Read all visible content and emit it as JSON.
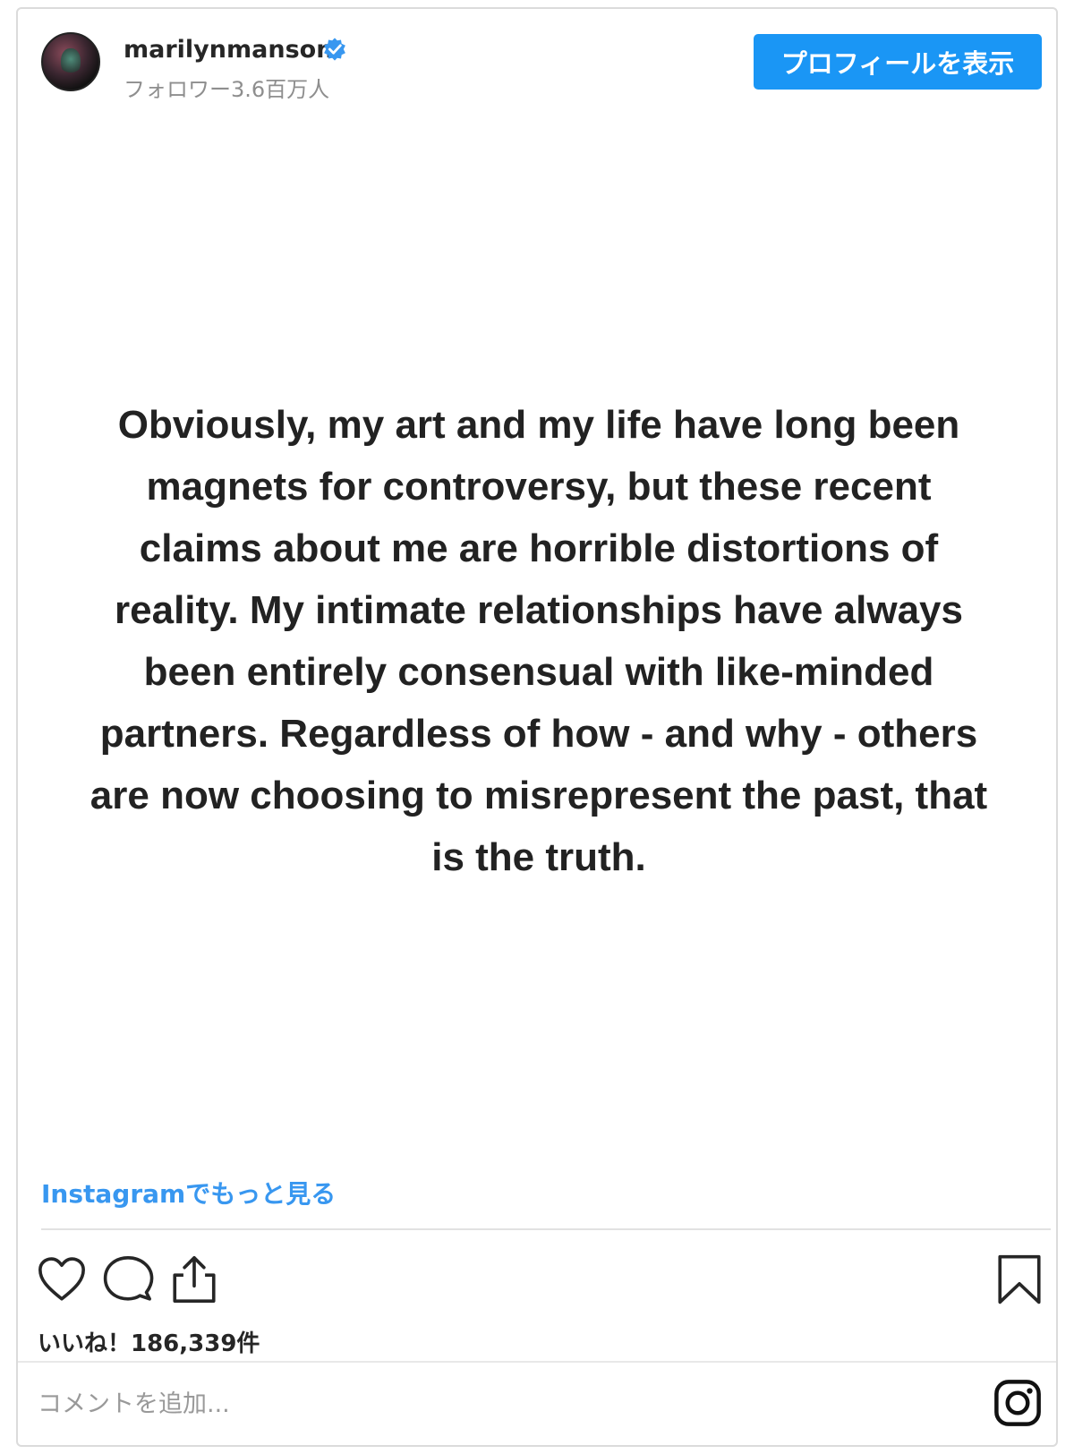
{
  "header": {
    "username": "marilynmanson",
    "followers": "フォロワー3.6百万人",
    "profile_button": "プロフィールを表示"
  },
  "post": {
    "text_lines": [
      "Obviously, my art and my life have long been",
      "magnets for controversy, but these recent",
      "claims about me are horrible distortions of",
      "reality. My intimate relationships have always",
      "been entirely consensual with like-minded",
      "partners. Regardless of how - and why - others",
      "are now choosing to misrepresent the past, that",
      "is the truth."
    ]
  },
  "more_link": "Instagramでもっと見る",
  "likes": "いいね！186,339件",
  "comment": {
    "placeholder": "コメントを追加..."
  },
  "icons": [
    "verified-icon",
    "heart-icon",
    "comment-icon",
    "share-icon",
    "bookmark-icon",
    "instagram-icon"
  ],
  "colors": {
    "accent": "#1a96f5",
    "link": "#3897f0",
    "muted": "#8e8e8e",
    "text": "#262626"
  }
}
